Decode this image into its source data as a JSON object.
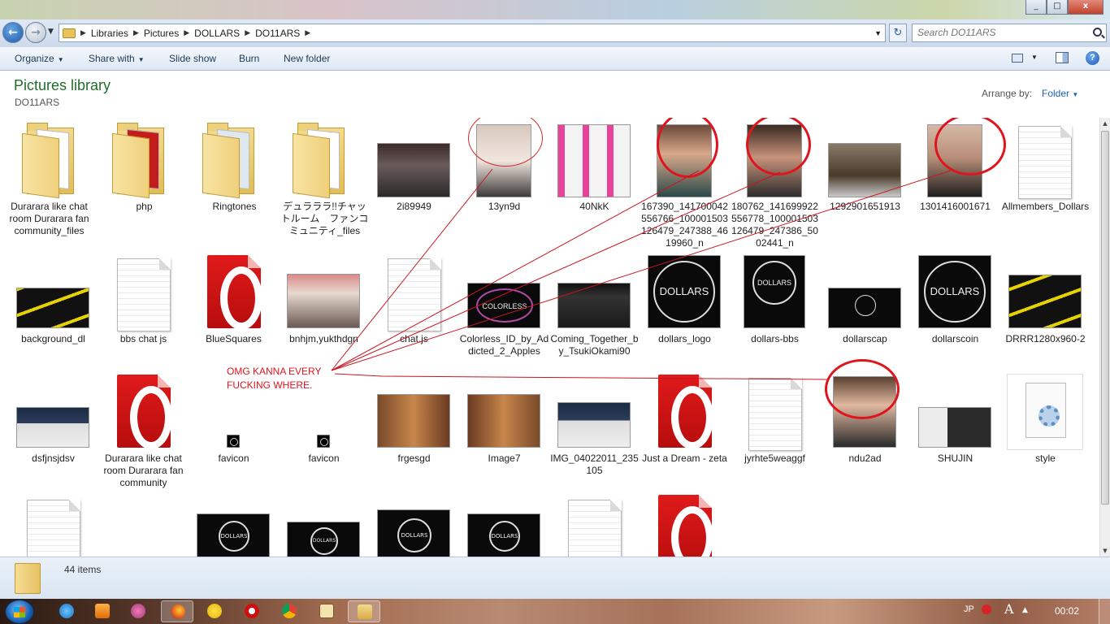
{
  "window": {
    "minimize": "_",
    "maximize": "□",
    "close": "x"
  },
  "nav": {
    "back": "←",
    "forward": "→",
    "breadcrumb": [
      "Libraries",
      "Pictures",
      "DOLLARS",
      "DO11ARS"
    ],
    "refresh": "↻",
    "search_placeholder": "Search DO11ARS"
  },
  "toolbar": {
    "organize": "Organize",
    "share_with": "Share with",
    "slide_show": "Slide show",
    "burn": "Burn",
    "new_folder": "New folder",
    "help": "?"
  },
  "header": {
    "title": "Pictures library",
    "subtitle": "DO11ARS",
    "arrange_label": "Arrange by:",
    "arrange_value": "Folder"
  },
  "items": [
    {
      "label": "Durarara like chat room   Durarara fan community_files",
      "kind": "folder"
    },
    {
      "label": "php",
      "kind": "folder"
    },
    {
      "label": "Ringtones",
      "kind": "folder"
    },
    {
      "label": "デュラララ!!チャットルーム　ファンコミュニティ_files",
      "kind": "folder"
    },
    {
      "label": "2i89949",
      "kind": "photo"
    },
    {
      "label": "13yn9d",
      "kind": "photo"
    },
    {
      "label": "40NkK",
      "kind": "photo"
    },
    {
      "label": "167390_141700042556766_100001503126479_247388_4619960_n",
      "kind": "photo"
    },
    {
      "label": "180762_141699922556778_100001503126479_247386_5002441_n",
      "kind": "photo"
    },
    {
      "label": "1292901651913",
      "kind": "photo"
    },
    {
      "label": "1301416001671",
      "kind": "photo"
    },
    {
      "label": "Allmembers_Dollars",
      "kind": "document"
    },
    {
      "label": "background_dl",
      "kind": "image"
    },
    {
      "label": "bbs chat js",
      "kind": "document"
    },
    {
      "label": "BlueSquares",
      "kind": "opera"
    },
    {
      "label": "bnhjm,yukthdgn",
      "kind": "photo"
    },
    {
      "label": "chat.js",
      "kind": "document"
    },
    {
      "label": "Colorless_ID_by_Addicted_2_Apples",
      "kind": "image"
    },
    {
      "label": "Coming_Together_by_TsukiOkami90",
      "kind": "image"
    },
    {
      "label": "dollars_logo",
      "kind": "image"
    },
    {
      "label": "dollars-bbs",
      "kind": "image"
    },
    {
      "label": "dollarscap",
      "kind": "image"
    },
    {
      "label": "dollarscoin",
      "kind": "image"
    },
    {
      "label": "DRRR1280x960-2",
      "kind": "image"
    },
    {
      "label": "dsfjnsjdsv",
      "kind": "image"
    },
    {
      "label": "Durarara like chat room   Durarara fan community",
      "kind": "opera"
    },
    {
      "label": "favicon",
      "kind": "icon"
    },
    {
      "label": "favicon",
      "kind": "icon"
    },
    {
      "label": "frgesgd",
      "kind": "photo"
    },
    {
      "label": "Image7",
      "kind": "photo"
    },
    {
      "label": "IMG_04022011_235105",
      "kind": "image"
    },
    {
      "label": "Just a Dream - zeta",
      "kind": "opera"
    },
    {
      "label": "jyrhte5weaggf",
      "kind": "document"
    },
    {
      "label": "ndu2ad",
      "kind": "photo"
    },
    {
      "label": "SHUJIN",
      "kind": "image"
    },
    {
      "label": "style",
      "kind": "css"
    }
  ],
  "logo_text": "DOLLARS",
  "colorless_text": "COLORLESS",
  "annotation": {
    "line1": "OMG KANNA EVERY",
    "line2": "FUCKING WHERE."
  },
  "status": {
    "item_count": "44 items"
  },
  "tray": {
    "language": "JP",
    "ime": "A",
    "expand": "▲",
    "clock": "00:02"
  },
  "colors": {
    "library_title": "#1e6d2a",
    "link_blue": "#1e63b5",
    "annotation_red": "#e0141d"
  }
}
